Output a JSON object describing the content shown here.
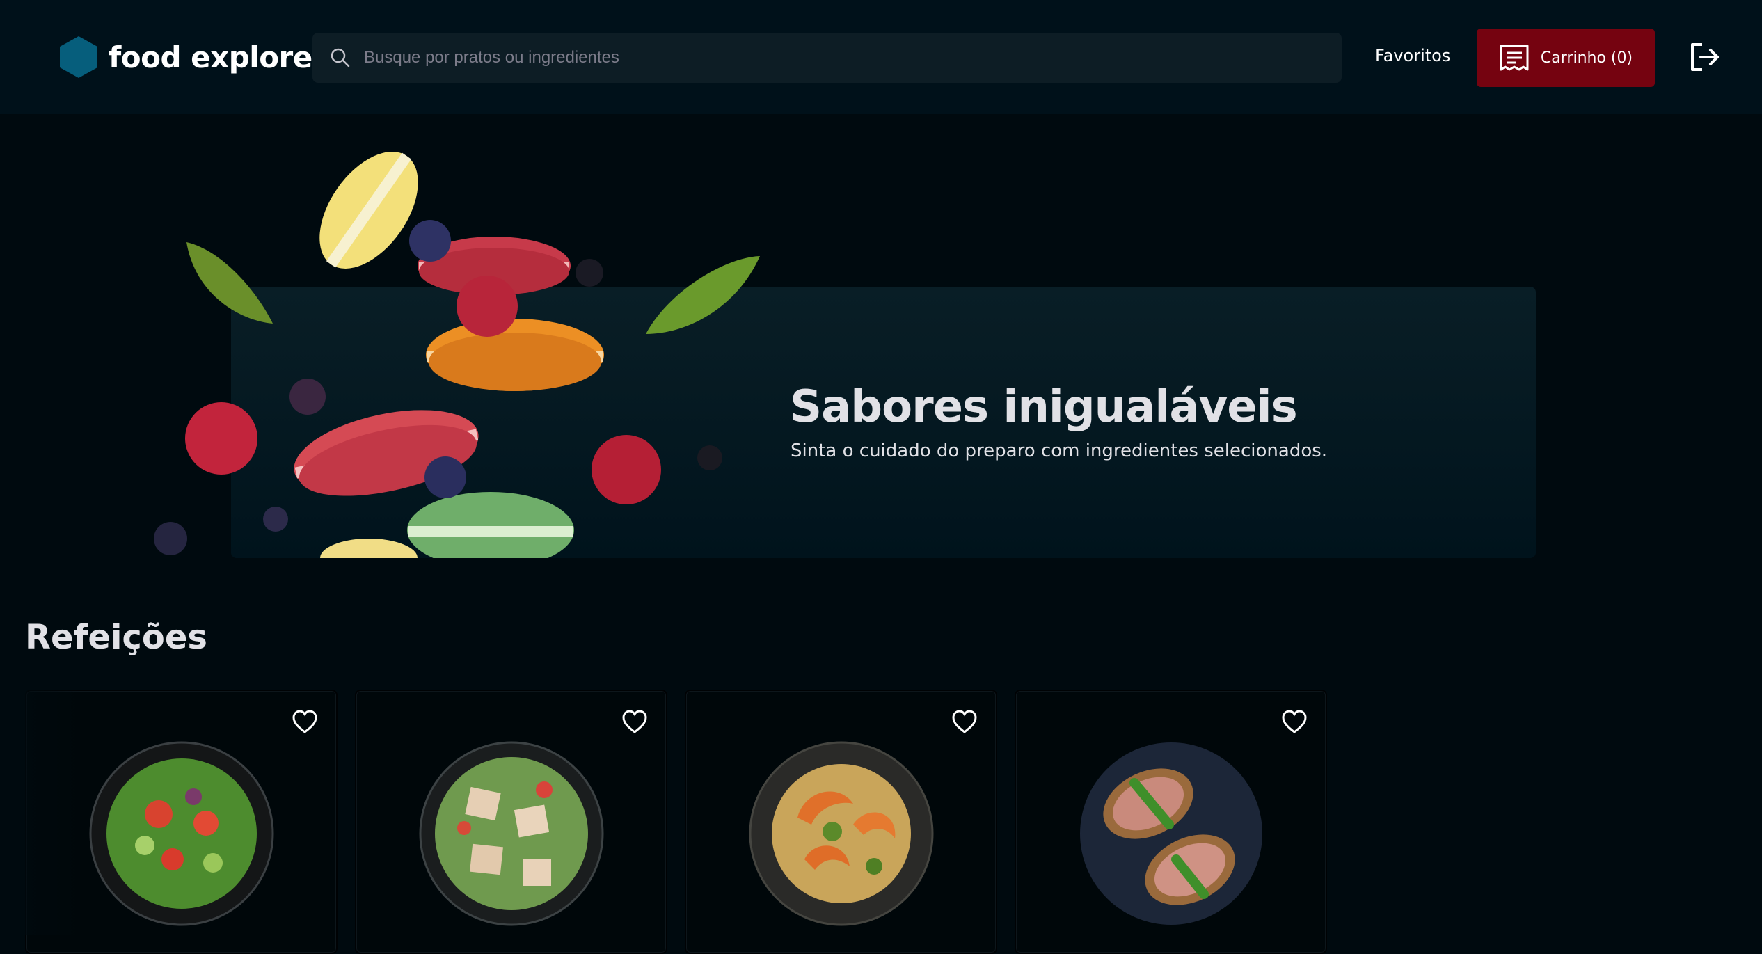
{
  "header": {
    "logo_text": "food explorer",
    "search_placeholder": "Busque por pratos ou ingredientes",
    "favorites_label": "Favoritos",
    "cart_label": "Carrinho (0)",
    "icons": [
      "hexagon-logo-icon",
      "search-icon",
      "receipt-icon",
      "sign-out-icon"
    ]
  },
  "hero": {
    "title": "Sabores inigualáveis",
    "subtitle": "Sinta o cuidado do preparo com ingredientes selecionados."
  },
  "sections": [
    {
      "title": "Refeições",
      "cards": [
        {
          "dish": "salad-1",
          "favorite_icon": "heart-icon"
        },
        {
          "dish": "salad-2",
          "favorite_icon": "heart-icon"
        },
        {
          "dish": "shrimp-pasta",
          "favorite_icon": "heart-icon"
        },
        {
          "dish": "bruschetta",
          "favorite_icon": "heart-icon"
        }
      ]
    }
  ],
  "colors": {
    "background": "#000a0f",
    "header": "#00111a",
    "search_bg": "#0d1d25",
    "cart_button": "#750310",
    "logo_accent": "#065e7c",
    "text": "#e1e1e6"
  }
}
